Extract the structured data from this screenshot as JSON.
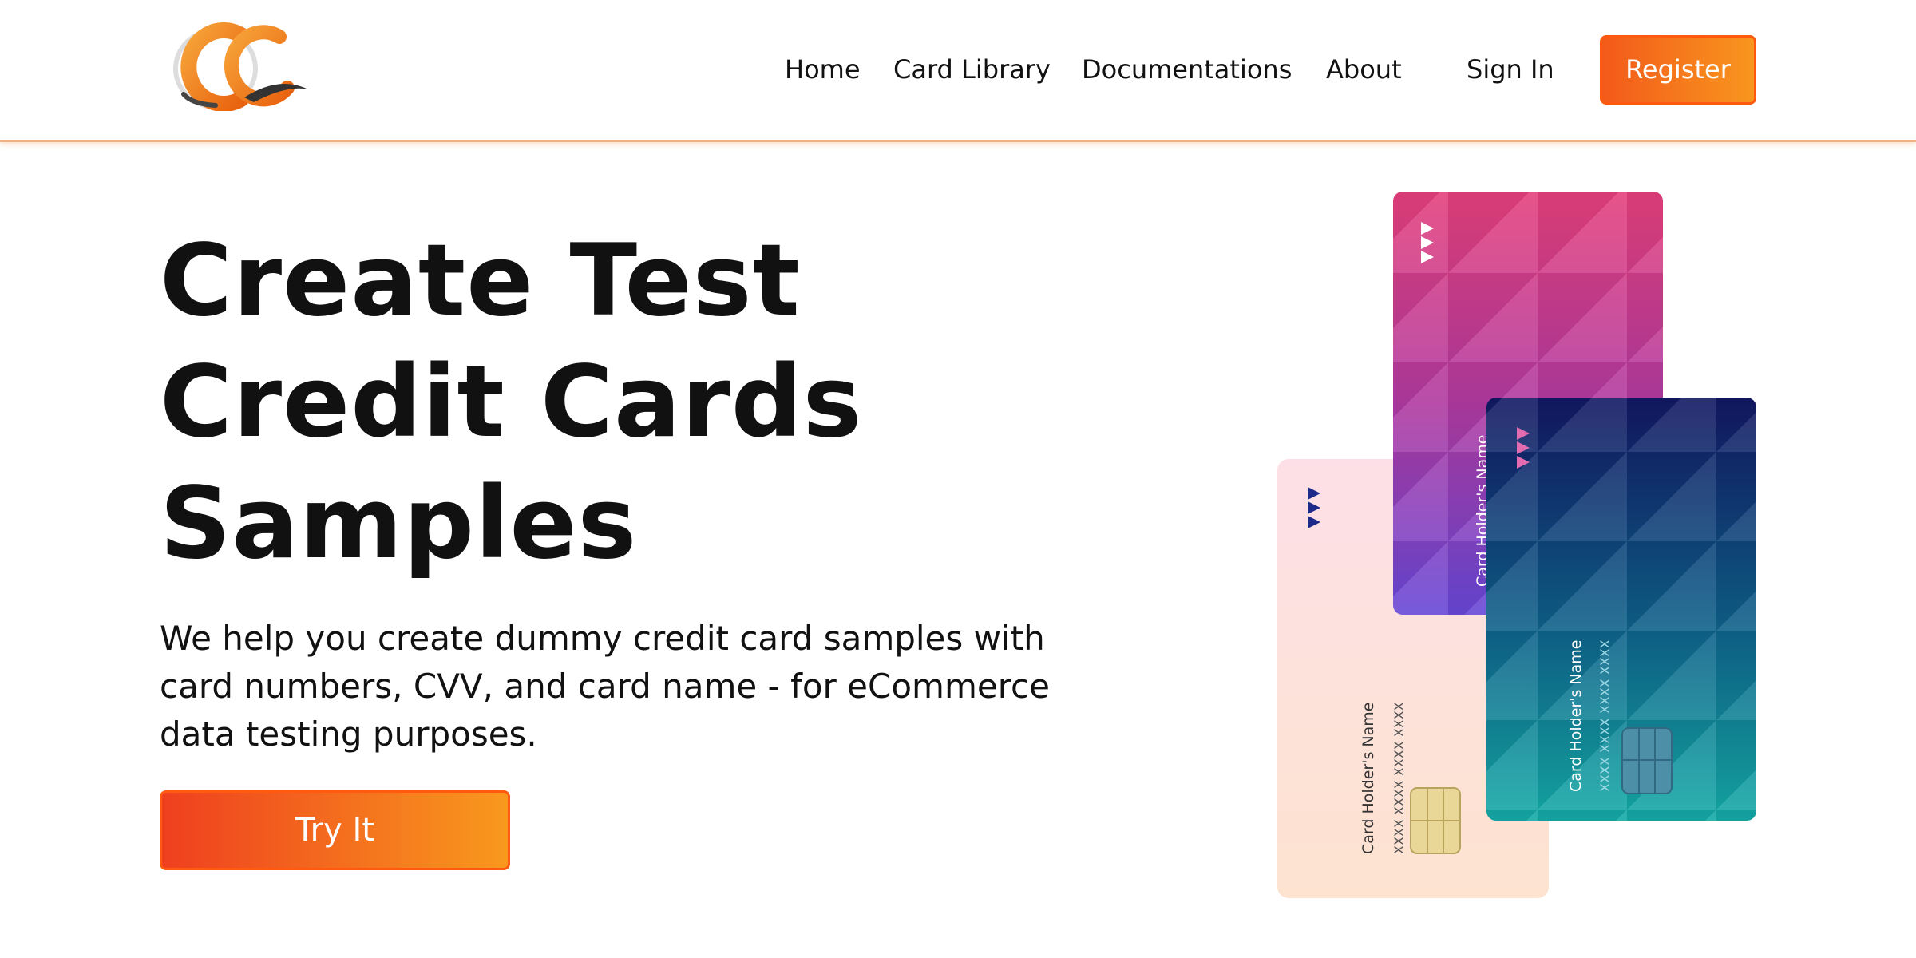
{
  "header": {
    "logo_alt": "CG",
    "nav": [
      {
        "label": "Home"
      },
      {
        "label": "Card Library"
      },
      {
        "label": "Documentations"
      },
      {
        "label": "About"
      },
      {
        "label": "Sign In"
      }
    ],
    "register_label": "Register"
  },
  "hero": {
    "title_lines": [
      "Create Test",
      "Credit Cards",
      "Samples"
    ],
    "subtitle": "We help you create dummy credit card samples with card numbers, CVV, and card name - for eCommerce data testing purposes.",
    "cta_label": "Try It"
  },
  "cards": {
    "holder_label": "Card Holder's Name",
    "number_group": "XXXX",
    "colors": {
      "pink_top": "#e03c7a",
      "pink_bottom": "#6a4ad6",
      "navy_top": "#131a63",
      "teal_bottom": "#15aaa8",
      "peach_top": "#fde0e6",
      "peach_bottom": "#fde3cf"
    }
  },
  "theme": {
    "accent_start": "#f35a1a",
    "accent_end": "#f8961e",
    "text": "#111111"
  }
}
